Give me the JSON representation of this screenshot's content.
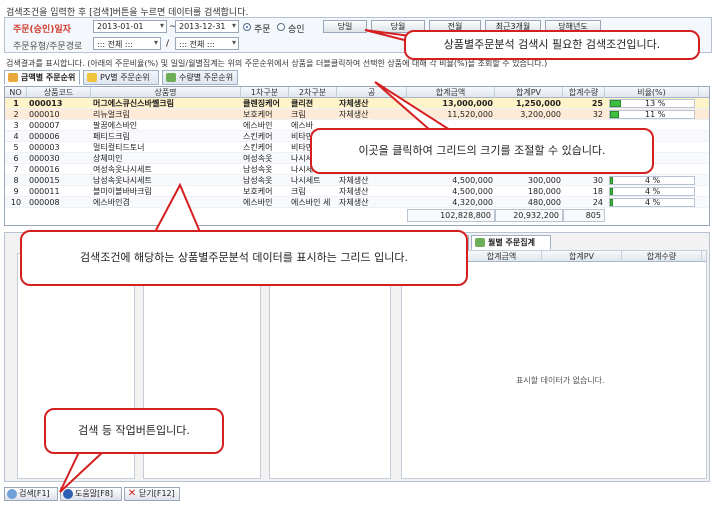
{
  "top_description": "검색조건을 입력한 후 [검색]버튼을 누르면 데이터를 검색합니다.",
  "conditions": {
    "date_label": "주문(승인)일자",
    "date_from": "2013-01-01",
    "date_sep": "~",
    "date_to": "2013-12-31",
    "radio_order": "주문",
    "radio_approve": "승인",
    "type_label": "주문유형/주문경로",
    "type_value": "::: 전체 :::",
    "slash": "/",
    "route_value": "::: 전체 :::",
    "btn_today": "당일",
    "btn_month": "당월",
    "btn_all": "전월",
    "btn_recent3": "최근3개월",
    "btn_year": "당해년도"
  },
  "result_hint": "검색결과를 표시합니다. (아래의 주문비율(%) 및 일일/월별집계는 위의 주문순위에서 상품을 더블클릭하여 선택한 상품에 대해 각 비율(%)을 조회할 수 있습니다.)",
  "tabs": [
    "금액별 주문순위",
    "PV별 주문순위",
    "수량별 주문순위"
  ],
  "grid": {
    "columns": [
      "NO",
      "상품코드",
      "상품명",
      "1차구분",
      "2차구분",
      "공",
      "합계금액",
      "합계PV",
      "합계수량",
      "비율(%)"
    ],
    "rows": [
      {
        "no": "1",
        "code": "000013",
        "name": "머그에스큐신스바쎌크림",
        "c1": "클렌징케어",
        "c2": "클리젼",
        "g": "자체생산",
        "amt": "13,000,000",
        "pv": "1,250,000",
        "qty": "25",
        "pct": 13,
        "pct_label": "13 %"
      },
      {
        "no": "2",
        "code": "000010",
        "name": "리뉴얼크림",
        "c1": "보호케어",
        "c2": "크림",
        "g": "자체생산",
        "amt": "11,520,000",
        "pv": "3,200,000",
        "qty": "32",
        "pct": 11,
        "pct_label": "11 %"
      },
      {
        "no": "3",
        "code": "000007",
        "name": "팔꿈에스바인",
        "c1": "에스바인",
        "c2": "에스바",
        "g": "",
        "amt": "",
        "pv": "",
        "qty": "",
        "pct": null,
        "pct_label": ""
      },
      {
        "no": "4",
        "code": "000006",
        "name": "페티드크림",
        "c1": "스킨케어",
        "c2": "비타민",
        "g": "",
        "amt": "",
        "pv": "",
        "qty": "",
        "pct": null,
        "pct_label": ""
      },
      {
        "no": "5",
        "code": "000003",
        "name": "멀티컬티드토너",
        "c1": "스킨케어",
        "c2": "비타민",
        "g": "",
        "amt": "",
        "pv": "",
        "qty": "",
        "pct": null,
        "pct_label": ""
      },
      {
        "no": "6",
        "code": "000030",
        "name": "상체미인",
        "c1": "여성속옷",
        "c2": "나시세",
        "g": "",
        "amt": "",
        "pv": "",
        "qty": "",
        "pct": null,
        "pct_label": ""
      },
      {
        "no": "7",
        "code": "000016",
        "name": "여성속옷나시세트",
        "c1": "남성속옷",
        "c2": "나시세",
        "g": "",
        "amt": "",
        "pv": "",
        "qty": "",
        "pct": null,
        "pct_label": ""
      },
      {
        "no": "8",
        "code": "000015",
        "name": "남성속옷나시세트",
        "c1": "남성속옷",
        "c2": "나시세트",
        "g": "자체생산",
        "amt": "4,500,000",
        "pv": "300,000",
        "qty": "30",
        "pct": 4,
        "pct_label": "4 %"
      },
      {
        "no": "9",
        "code": "000011",
        "name": "블미이볼바바크림",
        "c1": "보호케어",
        "c2": "크림",
        "g": "자체생산",
        "amt": "4,500,000",
        "pv": "180,000",
        "qty": "18",
        "pct": 4,
        "pct_label": "4 %"
      },
      {
        "no": "10",
        "code": "000008",
        "name": "에스바인겸",
        "c1": "에스바인",
        "c2": "에스바인 세",
        "g": "자체생산",
        "amt": "4,320,000",
        "pv": "480,000",
        "qty": "24",
        "pct": 4,
        "pct_label": "4 %"
      }
    ],
    "totals": {
      "amt": "102,828,800",
      "pv": "20,932,200",
      "qty": "805"
    }
  },
  "lower": {
    "tabs": [
      "철",
      "월별 주문집계"
    ],
    "columns": [
      "합계금액",
      "합계PV",
      "합계수량"
    ],
    "no_data": "표시할 데이터가 없습니다."
  },
  "bottom_buttons": [
    "검색[F1]",
    "도움말[F8]",
    "닫기[F12]"
  ],
  "callouts": {
    "conditions": "상품별주문분석 검색시 필요한 검색조건입니다.",
    "resize": "이곳을 클릭하여 그리드의 크기를 조절할 수 있습니다.",
    "grid": "검색조건에 해당하는 상품별주문분석 데이터를 표시하는 그리드 입니다.",
    "buttons": "검색 등 작업버튼입니다."
  },
  "colors": {
    "accent_red": "#d42020",
    "bar_green": "#3fbf3f",
    "tab_blue": "#9fb1c8"
  }
}
